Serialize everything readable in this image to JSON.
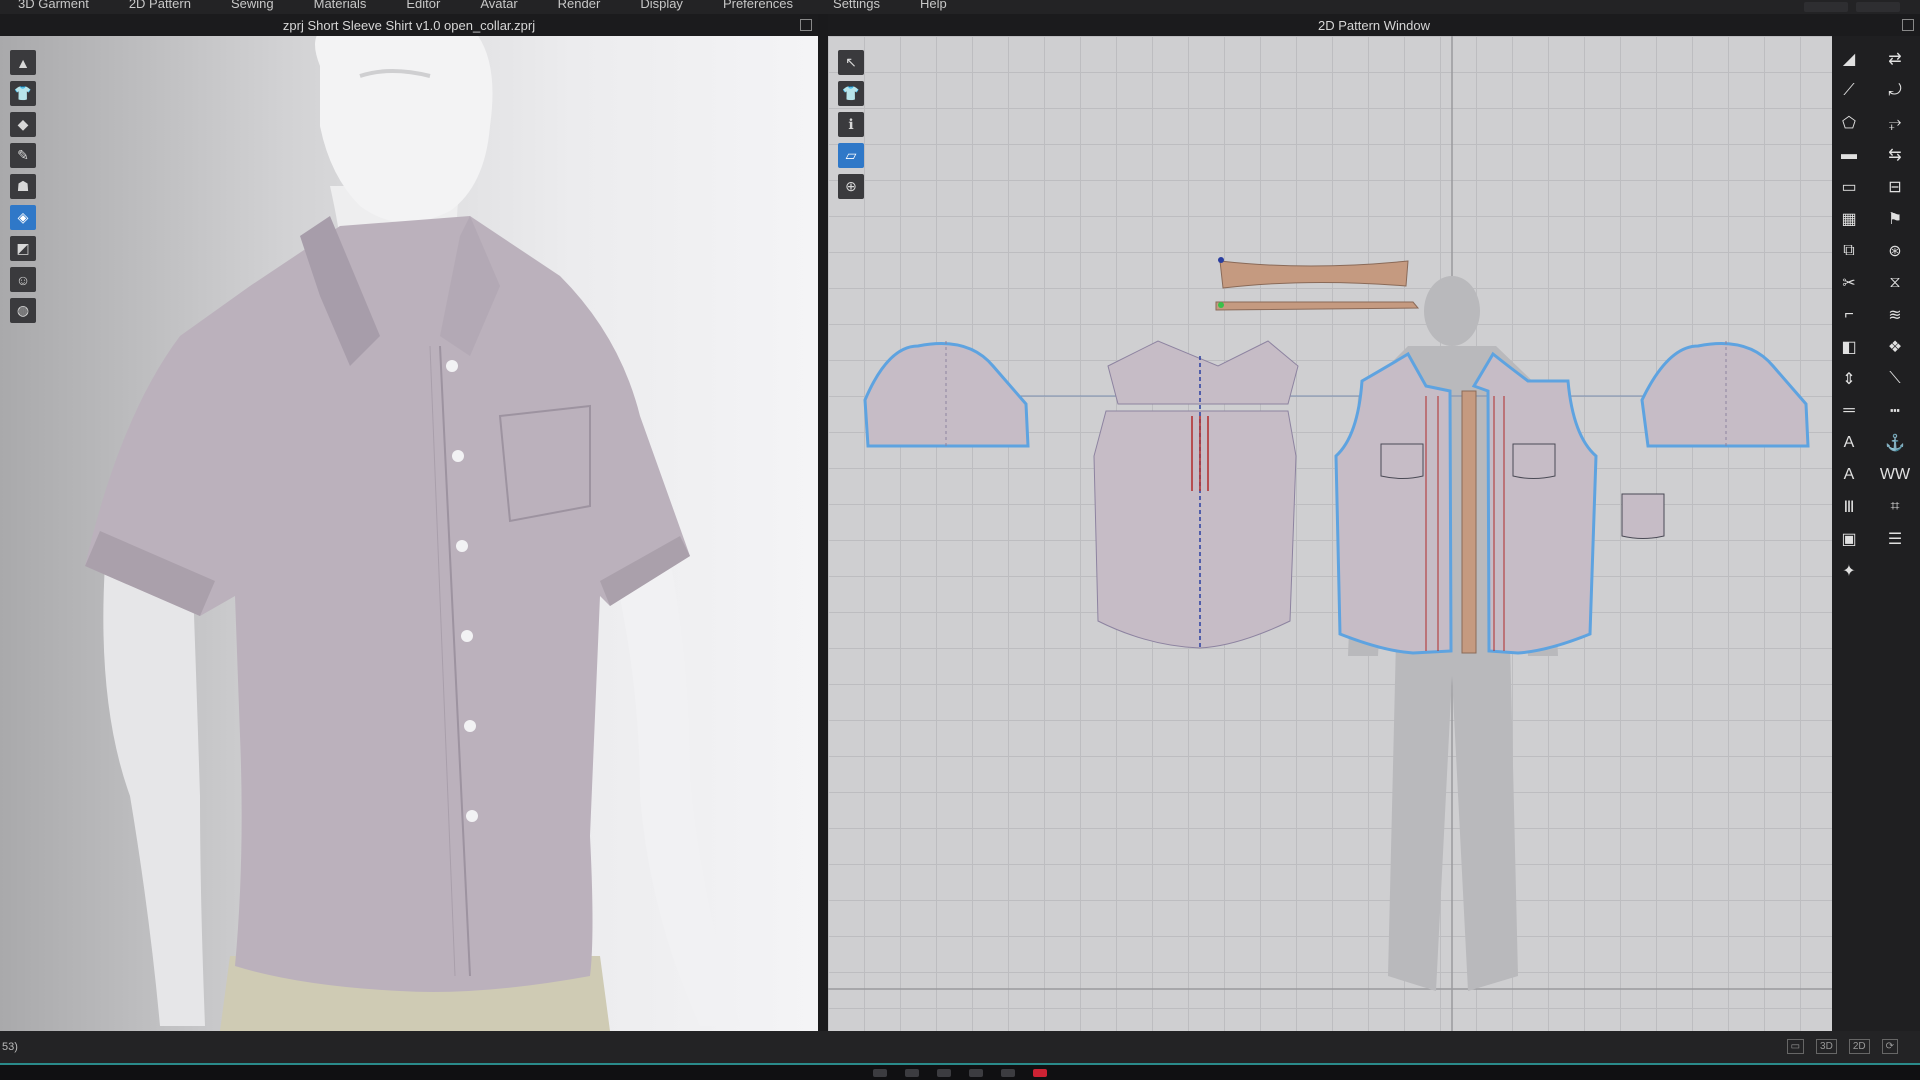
{
  "menu": {
    "items": [
      "3D Garment",
      "2D Pattern",
      "Sewing",
      "Materials",
      "Editor",
      "Avatar",
      "Render",
      "Display",
      "Preferences",
      "Settings",
      "Help"
    ]
  },
  "view3d": {
    "title": "zprj Short Sleeve Shirt v1.0 open_collar.zprj",
    "toolbar": [
      {
        "name": "simulation-icon",
        "glyph": "▲"
      },
      {
        "name": "garment-icon",
        "glyph": "👕"
      },
      {
        "name": "select-mesh-icon",
        "glyph": "◆"
      },
      {
        "name": "edit-pattern-icon",
        "glyph": "✎"
      },
      {
        "name": "fold-arrangement-icon",
        "glyph": "☗"
      },
      {
        "name": "transform-icon",
        "glyph": "◈",
        "active": true
      },
      {
        "name": "pin-icon",
        "glyph": "◩"
      },
      {
        "name": "avatar-icon",
        "glyph": "☺"
      },
      {
        "name": "texture-icon",
        "glyph": "◍"
      }
    ]
  },
  "view2d": {
    "title": "2D Pattern Window",
    "toolbar": [
      {
        "name": "transform-pattern-icon",
        "glyph": "↖"
      },
      {
        "name": "show-garment-icon",
        "glyph": "👕"
      },
      {
        "name": "info-icon",
        "glyph": "ℹ"
      },
      {
        "name": "sewing-display-icon",
        "glyph": "▱",
        "active": true
      },
      {
        "name": "lock-icon",
        "glyph": "⊕"
      }
    ]
  },
  "right_toolbar": [
    {
      "name": "transform-icon",
      "glyph": "◢"
    },
    {
      "name": "sewing-icon",
      "glyph": "⇄"
    },
    {
      "name": "edit-curve-icon",
      "glyph": "⟋"
    },
    {
      "name": "seam-icon",
      "glyph": "⤾"
    },
    {
      "name": "polygon-icon",
      "glyph": "⬠"
    },
    {
      "name": "segment-sewing-icon",
      "glyph": "⥅"
    },
    {
      "name": "rectangle-icon",
      "glyph": "▬"
    },
    {
      "name": "free-sewing-icon",
      "glyph": "⇆"
    },
    {
      "name": "internal-polygon-icon",
      "glyph": "▭"
    },
    {
      "name": "press-icon",
      "glyph": "⊟"
    },
    {
      "name": "grid-icon",
      "glyph": "▦"
    },
    {
      "name": "tack-icon",
      "glyph": "⚑"
    },
    {
      "name": "pattern-stack-icon",
      "glyph": "⧉"
    },
    {
      "name": "button-icon",
      "glyph": "⊛"
    },
    {
      "name": "cut-icon",
      "glyph": "✂"
    },
    {
      "name": "zip-icon",
      "glyph": "⧖"
    },
    {
      "name": "fold-icon",
      "glyph": "⌐"
    },
    {
      "name": "topstitch-icon",
      "glyph": "≋"
    },
    {
      "name": "pleat-icon",
      "glyph": "◧"
    },
    {
      "name": "puckering-icon",
      "glyph": "❖"
    },
    {
      "name": "ruler-icon",
      "glyph": "⇕"
    },
    {
      "name": "measure-icon",
      "glyph": "⟍"
    },
    {
      "name": "straight-ruler-icon",
      "glyph": "═"
    },
    {
      "name": "circumference-icon",
      "glyph": "┅"
    },
    {
      "name": "text-icon",
      "glyph": "A"
    },
    {
      "name": "anchor-icon",
      "glyph": "⚓"
    },
    {
      "name": "annotation-icon",
      "glyph": "A"
    },
    {
      "name": "pleat-line-icon",
      "glyph": "WW"
    },
    {
      "name": "stripe-icon",
      "glyph": "Ⅲ"
    },
    {
      "name": "tape-icon",
      "glyph": "⌗"
    },
    {
      "name": "graphic-icon",
      "glyph": "▣"
    },
    {
      "name": "stack-icon",
      "glyph": "☰"
    },
    {
      "name": "avatar-pose-icon",
      "glyph": "✦"
    }
  ],
  "status": {
    "left": "53)",
    "views": [
      "▭",
      "3D",
      "2D",
      "⟳"
    ]
  },
  "colors": {
    "fabric": "#c6bcc6",
    "outline_blue": "#5ea3e0",
    "trim": "#c59a80"
  }
}
